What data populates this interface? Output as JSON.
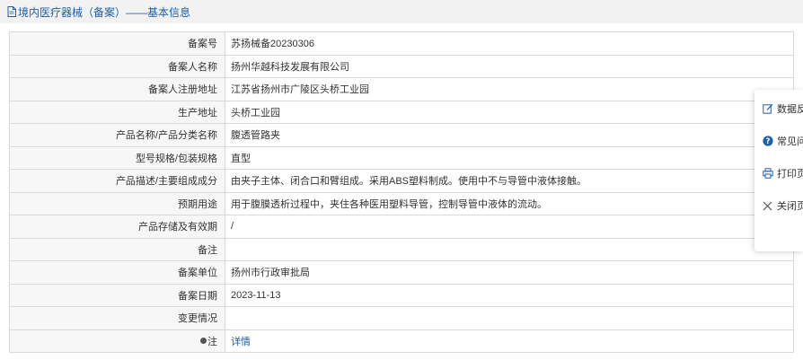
{
  "header": {
    "title": "境内医疗器械（备案）——基本信息"
  },
  "rows": [
    {
      "label": "备案号",
      "value": "苏扬械备20230306"
    },
    {
      "label": "备案人名称",
      "value": "扬州华越科技发展有限公司"
    },
    {
      "label": "备案人注册地址",
      "value": "江苏省扬州市广陵区头桥工业园"
    },
    {
      "label": "生产地址",
      "value": "头桥工业园"
    },
    {
      "label": "产品名称/产品分类名称",
      "value": "腹透管路夹"
    },
    {
      "label": "型号规格/包装规格",
      "value": "直型"
    },
    {
      "label": "产品描述/主要组成成分",
      "value": "由夹子主体、闭合口和臂组成。采用ABS塑料制成。使用中不与导管中液体接触。"
    },
    {
      "label": "预期用途",
      "value": "用于腹膜透析过程中，夹住各种医用塑料导管，控制导管中液体的流动。"
    },
    {
      "label": "产品存储及有效期",
      "value": "/"
    },
    {
      "label": "备注",
      "value": ""
    },
    {
      "label": "备案单位",
      "value": "扬州市行政审批局"
    },
    {
      "label": "备案日期",
      "value": "2023-11-13"
    },
    {
      "label": "变更情况",
      "value": ""
    }
  ],
  "note_row": {
    "label": "注",
    "icon": "pin-icon",
    "link": "详情"
  },
  "float_menu": [
    {
      "icon": "edit-icon",
      "label": "数据反馈"
    },
    {
      "icon": "question-icon",
      "label": "常见问题"
    },
    {
      "icon": "printer-icon",
      "label": "打印页面"
    },
    {
      "icon": "close-icon",
      "label": "关闭页面"
    }
  ],
  "colors": {
    "link": "#1f5fa6",
    "title_bg": "#f2f2f2",
    "label_bg": "#f7f7f7",
    "border": "#d9d9d9"
  }
}
